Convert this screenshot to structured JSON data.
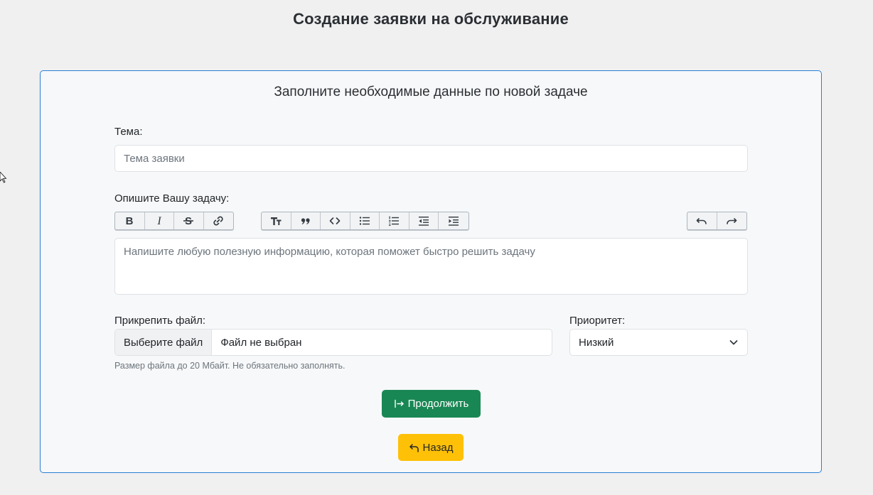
{
  "page": {
    "title": "Создание заявки на обслуживание"
  },
  "form": {
    "heading": "Заполните необходимые данные по новой задаче",
    "subject": {
      "label": "Тема:",
      "placeholder": "Тема заявки",
      "value": ""
    },
    "description": {
      "label": "Опишите Вашу задачу:",
      "placeholder": "Напишите любую полезную информацию, которая поможет быстро решить задачу"
    },
    "toolbar": {
      "groups": [
        [
          "bold-icon",
          "italic-icon",
          "strikethrough-icon",
          "link-icon"
        ],
        [
          "heading-icon",
          "quote-icon",
          "code-icon",
          "bullet-list-icon",
          "numbered-list-icon",
          "outdent-icon",
          "indent-icon"
        ],
        [
          "undo-icon",
          "redo-icon"
        ]
      ]
    },
    "attachment": {
      "label": "Прикрепить файл:",
      "button_label": "Выберите файл",
      "status": "Файл не выбран",
      "hint": "Размер файла до 20 Мбайт. Не обязательно заполнять."
    },
    "priority": {
      "label": "Приоритет:",
      "selected": "Низкий"
    },
    "continue_label": "Продолжить",
    "back_label": "Назад"
  },
  "colors": {
    "card_border": "#2a7fd4",
    "continue_bg": "#198754",
    "back_bg": "#ffc107"
  }
}
